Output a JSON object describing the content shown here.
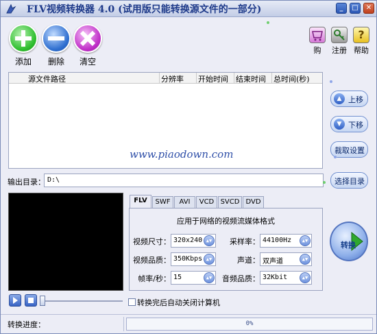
{
  "window": {
    "title": "FLV视频转换器 4.0 (试用版只能转换源文件的一部分)",
    "controls": [
      "minimize",
      "maximize",
      "close"
    ]
  },
  "toolbar": {
    "add_label": "添加",
    "delete_label": "删除",
    "clear_label": "清空",
    "buy_label": "购",
    "register_label": "注册",
    "help_label": "帮助"
  },
  "filelist": {
    "columns": [
      "源文件路径",
      "分辨率",
      "开始时间",
      "结束时间",
      "总时间(秒)"
    ],
    "rows": [],
    "watermark": "www.piaodown.com"
  },
  "side": {
    "up_label": "上移",
    "down_label": "下移",
    "crop_label": "裁取设置",
    "choose_dir_label": "选择目录"
  },
  "output": {
    "label": "输出目录：",
    "value": "D:\\"
  },
  "tabs": [
    "FLV",
    "SWF",
    "AVI",
    "VCD",
    "SVCD",
    "DVD"
  ],
  "active_tab": "FLV",
  "settings": {
    "title": "应用于网络的视频流媒体格式",
    "video_size_label": "视频尺寸：",
    "video_size_value": "320x240",
    "video_quality_label": "视频品质：",
    "video_quality_value": "350Kbps",
    "fps_label": "帧率/秒：",
    "fps_value": "15",
    "sample_rate_label": "采样率：",
    "sample_rate_value": "44100Hz",
    "channel_label": "声道：",
    "channel_value": "双声道",
    "audio_quality_label": "音频品质：",
    "audio_quality_value": "32Kbit"
  },
  "convert_label": "转换",
  "auto_shutdown": {
    "label": "转换完后自动关闭计算机",
    "checked": false
  },
  "status": {
    "progress_label": "转换进度：",
    "percent": "0%"
  },
  "colors": {
    "add": "#2fbf2f",
    "delete": "#2f6fd0",
    "clear": "#c02fc8",
    "accent": "#2a56b4"
  }
}
